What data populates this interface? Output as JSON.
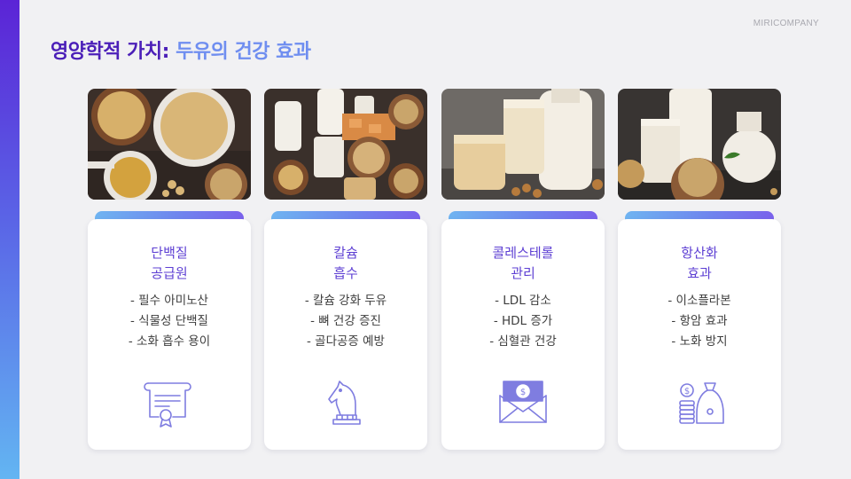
{
  "brand": "MIRICOMPANY",
  "title": {
    "part1": "영양학적 가치:",
    "part2": "두유의 건강 효과"
  },
  "colors": {
    "accent_dark": "#4b1fb8",
    "accent_light": "#6f8ef0",
    "heading": "#5d3fd3",
    "icon": "#7f7de0"
  },
  "cards": [
    {
      "image": "soybean-bowls-photo",
      "heading": [
        "단백질",
        "공급원"
      ],
      "items": [
        "- 필수 아미노산",
        "- 식물성 단백질",
        "- 소화 흡수 용이"
      ],
      "icon": "certificate-icon"
    },
    {
      "image": "soy-milk-and-tofu-photo",
      "heading": [
        "칼슘",
        "흡수"
      ],
      "items": [
        "- 칼슘 강화 두유",
        "- 뼈 건강 증진",
        "- 골다공증 예방"
      ],
      "icon": "chess-knight-icon"
    },
    {
      "image": "soy-milk-glasses-photo",
      "heading": [
        "콜레스테롤",
        "관리"
      ],
      "items": [
        "- LDL 감소",
        "- HDL 증가",
        "- 심혈관 건강"
      ],
      "icon": "money-envelope-icon"
    },
    {
      "image": "soy-milk-bottles-photo",
      "heading": [
        "항산화",
        "효과"
      ],
      "items": [
        "- 이소플라본",
        "- 항암 효과",
        "- 노화 방지"
      ],
      "icon": "money-bag-coins-icon"
    }
  ]
}
